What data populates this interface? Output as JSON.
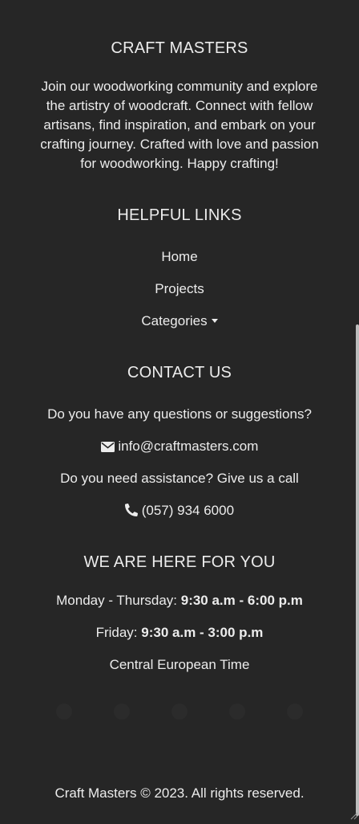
{
  "about": {
    "title": "CRAFT MASTERS",
    "lines": [
      "Join our woodworking community and explore",
      "the artistry of woodcraft. Connect with fellow",
      "artisans, find inspiration, and embark on your",
      "crafting journey. Crafted with love and passion",
      "for woodworking. Happy crafting!"
    ]
  },
  "links": {
    "title": "HELPFUL LINKS",
    "home": "Home",
    "projects": "Projects",
    "categories": "Categories"
  },
  "contact": {
    "title": "CONTACT US",
    "question": "Do you have any questions or suggestions?",
    "email": "info@craftmasters.com",
    "assistance": "Do you need assistance? Give us a call",
    "phone": "(057) 934 6000"
  },
  "hours": {
    "title": "WE ARE HERE FOR YOU",
    "weekday_label": "Monday - Thursday:",
    "weekday_time": "9:30 a.m - 6:00 p.m",
    "friday_label": "Friday:",
    "friday_time": "9:30 a.m - 3:00 p.m",
    "timezone": "Central European Time"
  },
  "social": [
    "facebook-icon",
    "twitter-icon",
    "instagram-icon",
    "pinterest-icon",
    "youtube-icon"
  ],
  "footer": {
    "copyright": "Craft Masters © 2023. All rights reserved."
  },
  "colors": {
    "background": "#262626",
    "text": "#ececec"
  }
}
